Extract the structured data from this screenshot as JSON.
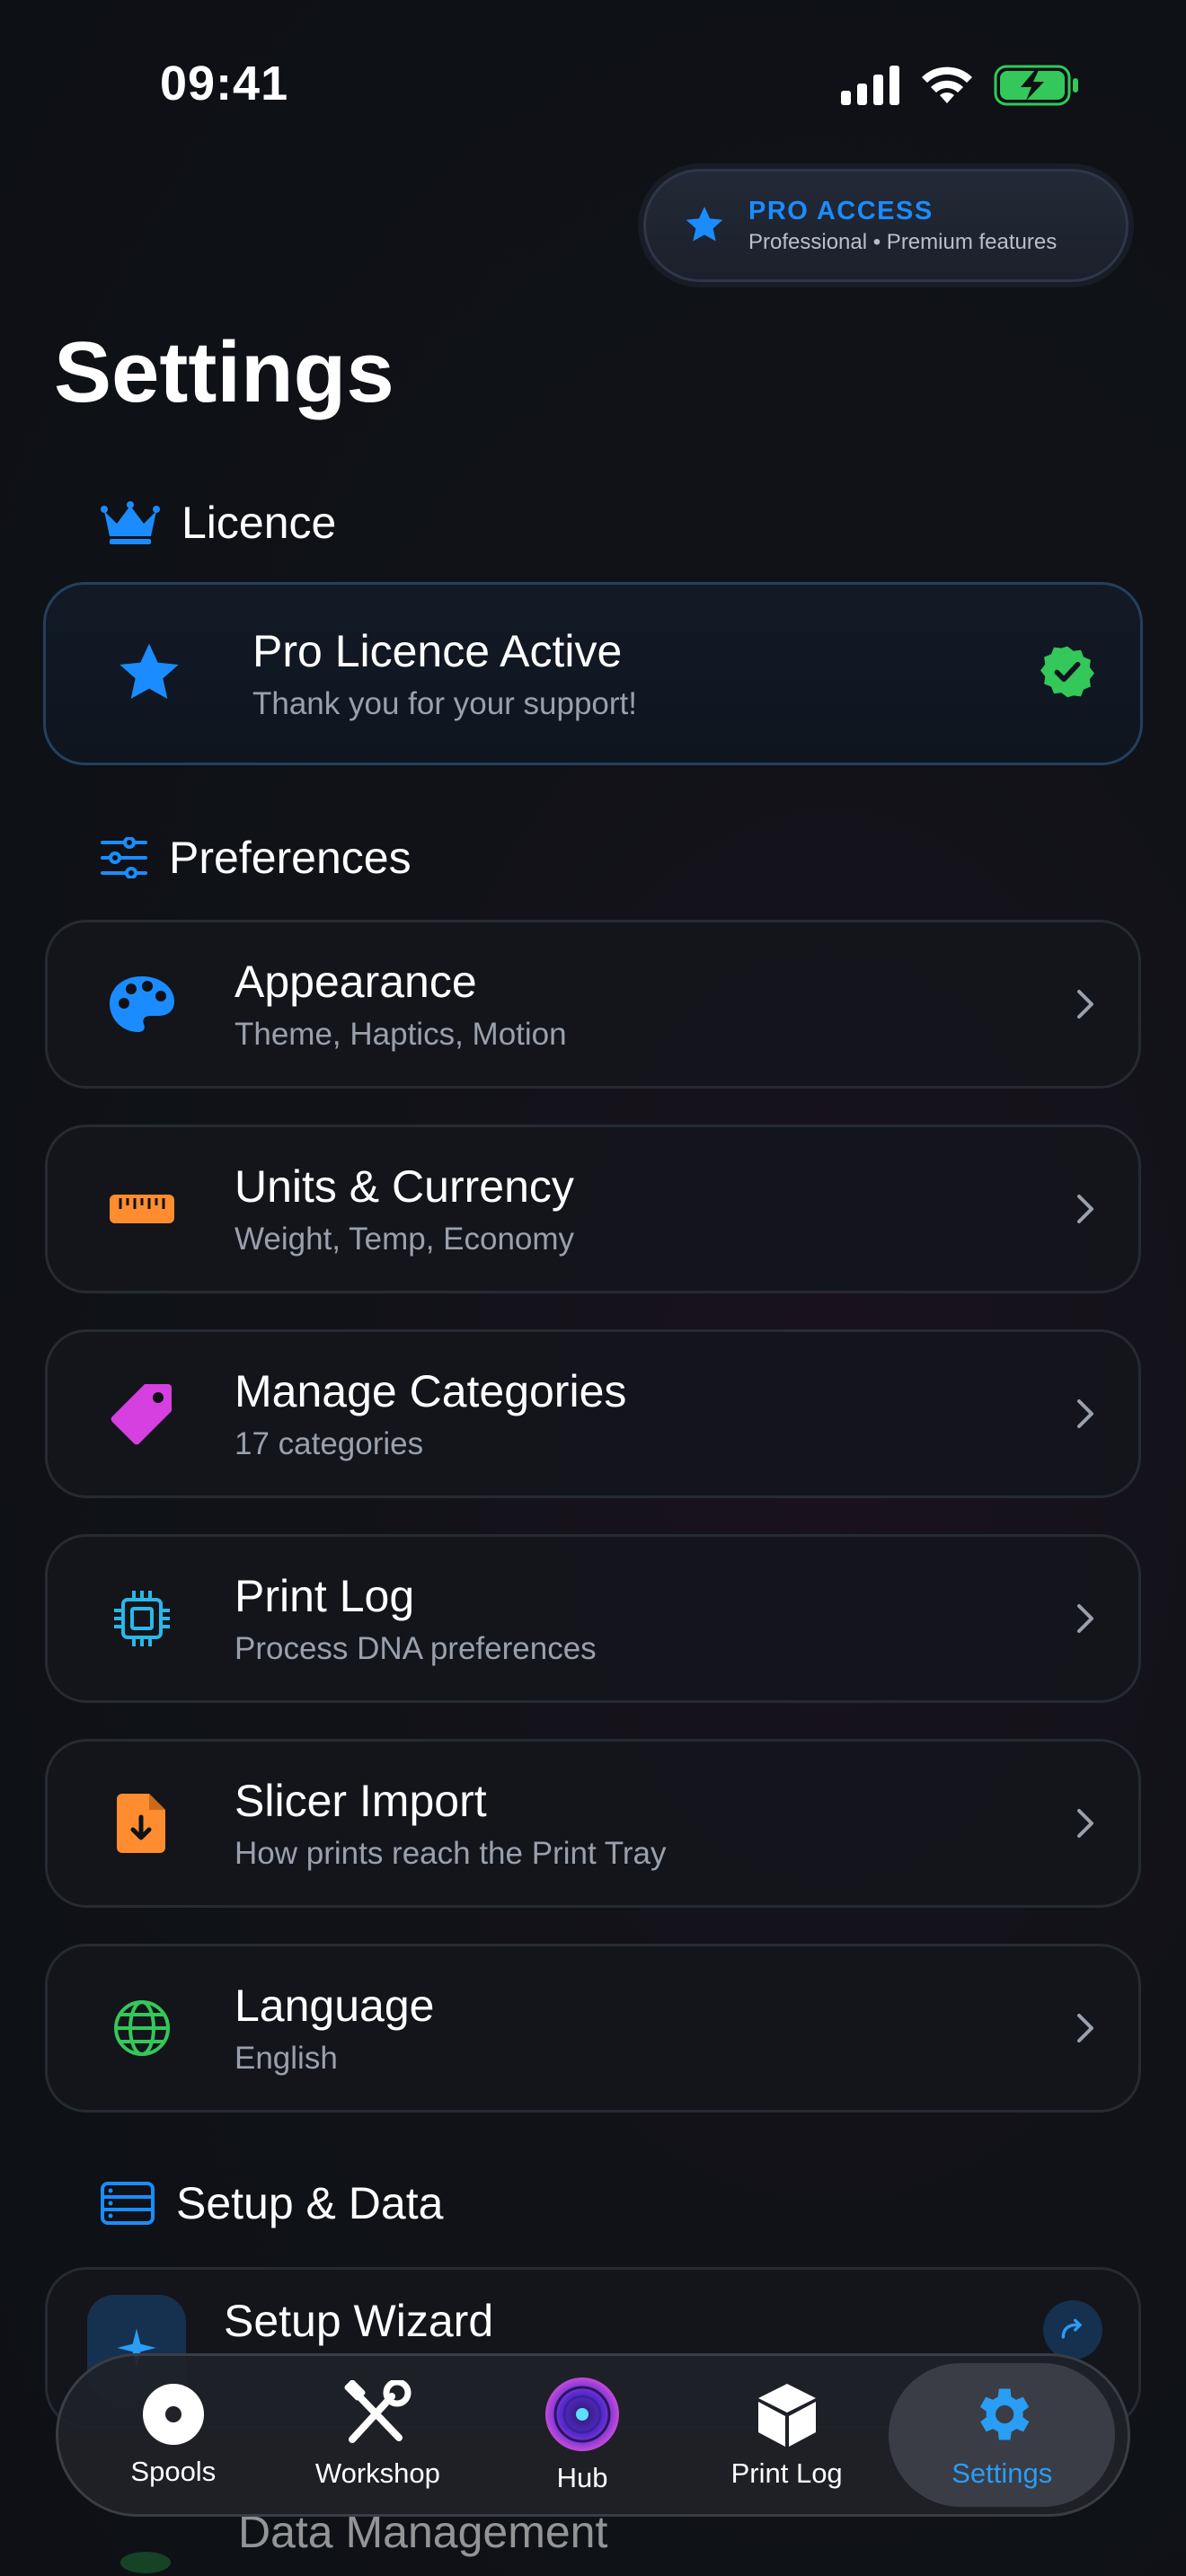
{
  "status": {
    "time": "09:41"
  },
  "pro_badge": {
    "title": "PRO ACCESS",
    "subtitle": "Professional • Premium features",
    "icon": "star-icon"
  },
  "page": {
    "title": "Settings"
  },
  "sections": {
    "licence": {
      "title": "Licence",
      "icon": "crown-icon"
    },
    "preferences": {
      "title": "Preferences",
      "icon": "sliders-icon"
    },
    "setup": {
      "title": "Setup & Data",
      "icon": "server-icon"
    }
  },
  "licence_card": {
    "title": "Pro Licence Active",
    "subtitle": "Thank you for your support!",
    "icon": "star-icon",
    "status_icon": "verified-badge-icon"
  },
  "preferences": [
    {
      "title": "Appearance",
      "subtitle": "Theme, Haptics, Motion",
      "icon": "palette-icon",
      "color": "#1a8cff"
    },
    {
      "title": "Units & Currency",
      "subtitle": "Weight, Temp, Economy",
      "icon": "ruler-icon",
      "color": "#ff8c2e"
    },
    {
      "title": "Manage Categories",
      "subtitle": "17 categories",
      "icon": "tag-icon",
      "color": "#d63fe0"
    },
    {
      "title": "Print Log",
      "subtitle": "Process DNA preferences",
      "icon": "chip-icon",
      "color": "#2ab8e8"
    },
    {
      "title": "Slicer Import",
      "subtitle": "How prints reach the Print Tray",
      "icon": "file-import-icon",
      "color": "#ff8c2e"
    },
    {
      "title": "Language",
      "subtitle": "English",
      "icon": "globe-icon",
      "color": "#34c759"
    }
  ],
  "setup_items": [
    {
      "title": "Setup Wizard",
      "icon": "sparkle-icon"
    },
    {
      "title": "Data Management",
      "icon": "database-icon"
    }
  ],
  "tabs": [
    {
      "label": "Spools",
      "icon": "spool-icon"
    },
    {
      "label": "Workshop",
      "icon": "tools-icon"
    },
    {
      "label": "Hub",
      "icon": "hub-disc-icon"
    },
    {
      "label": "Print Log",
      "icon": "cube-icon"
    },
    {
      "label": "Settings",
      "icon": "gear-icon",
      "active": true
    }
  ],
  "colors": {
    "accent": "#1a8cff",
    "active_tab": "#2a9df4",
    "battery": "#34c759"
  }
}
